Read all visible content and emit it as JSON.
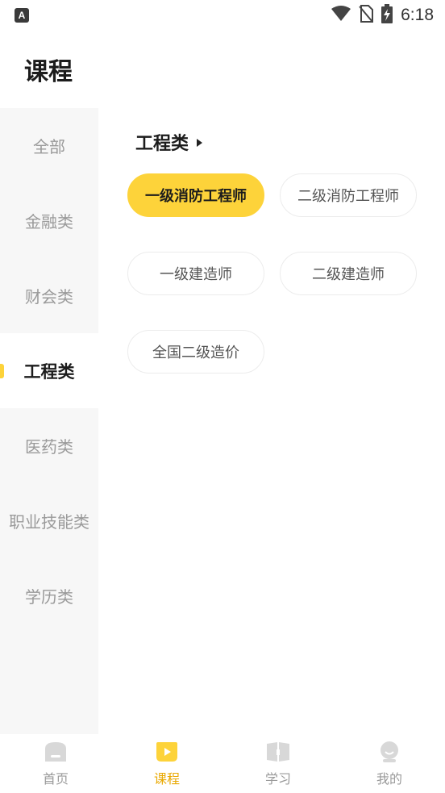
{
  "status_bar": {
    "app_icon_letter": "A",
    "time": "6:18",
    "icons": [
      "wifi-icon",
      "no-sim-icon",
      "battery-charging-icon"
    ]
  },
  "page": {
    "title": "课程"
  },
  "sidebar": {
    "items": [
      {
        "label": "全部",
        "active": false
      },
      {
        "label": "金融类",
        "active": false
      },
      {
        "label": "财会类",
        "active": false
      },
      {
        "label": "工程类",
        "active": true
      },
      {
        "label": "医药类",
        "active": false
      },
      {
        "label": "职业技能类",
        "active": false
      },
      {
        "label": "学历类",
        "active": false
      }
    ]
  },
  "content": {
    "section_title": "工程类",
    "chips": [
      {
        "label": "一级消防工程师",
        "selected": true
      },
      {
        "label": "二级消防工程师",
        "selected": false
      },
      {
        "label": "一级建造师",
        "selected": false
      },
      {
        "label": "二级建造师",
        "selected": false
      },
      {
        "label": "全国二级造价",
        "selected": false
      }
    ]
  },
  "bottom_nav": {
    "items": [
      {
        "label": "首页",
        "icon": "home-icon",
        "active": false
      },
      {
        "label": "课程",
        "icon": "course-play-icon",
        "active": true
      },
      {
        "label": "学习",
        "icon": "book-icon",
        "active": false
      },
      {
        "label": "我的",
        "icon": "profile-icon",
        "active": false
      }
    ]
  },
  "colors": {
    "accent": "#fdd33a",
    "active_nav_text": "#e9a800",
    "inactive_text": "#9a9a9a",
    "sidebar_bg": "#f7f7f7"
  }
}
